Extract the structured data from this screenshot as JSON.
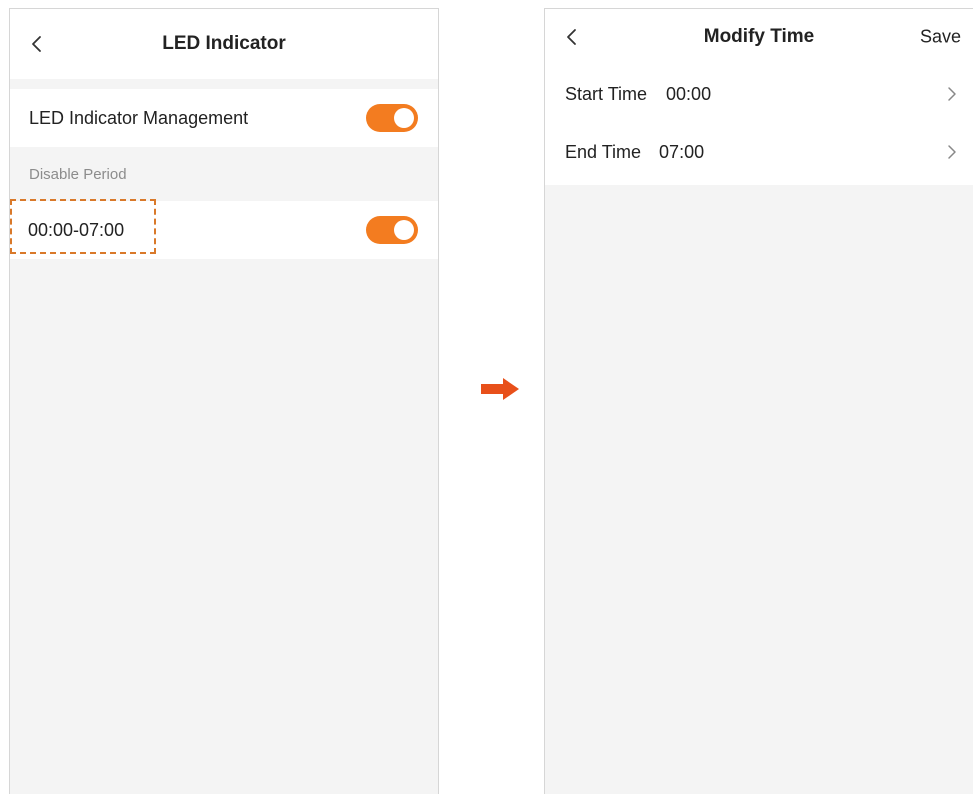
{
  "left_screen": {
    "title": "LED Indicator",
    "management_label": "LED Indicator Management",
    "management_enabled": true,
    "section_label": "Disable Period",
    "period_value": "00:00-07:00",
    "period_enabled": true
  },
  "right_screen": {
    "title": "Modify Time",
    "save_label": "Save",
    "start_label": "Start Time",
    "start_value": "00:00",
    "end_label": "End Time",
    "end_value": "07:00"
  },
  "colors": {
    "accent": "#f37c20",
    "highlight_border": "#d9792a",
    "arrow": "#e8501a",
    "background": "#f4f4f4"
  },
  "icons": {
    "back": "chevron-left-icon",
    "forward": "chevron-right-icon",
    "transition": "arrow-right-icon"
  }
}
